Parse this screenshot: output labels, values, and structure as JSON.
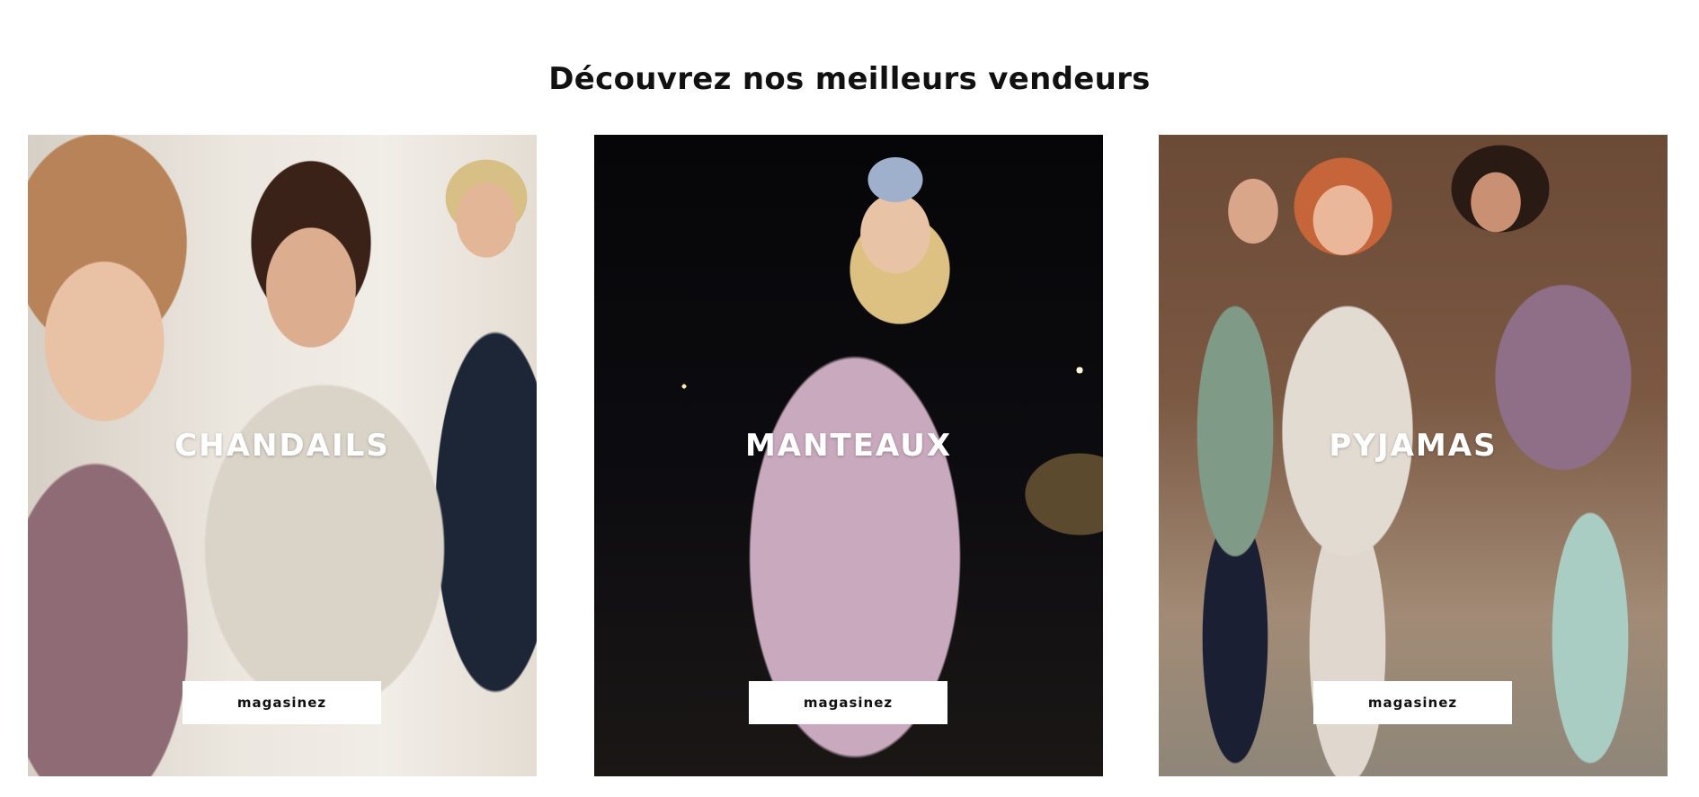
{
  "section": {
    "title": "Découvrez nos meilleurs vendeurs"
  },
  "cards": [
    {
      "title": "CHANDAILS",
      "button_label": "magasinez"
    },
    {
      "title": "MANTEAUX",
      "button_label": "magasinez"
    },
    {
      "title": "PYJAMAS",
      "button_label": "magasinez"
    }
  ]
}
